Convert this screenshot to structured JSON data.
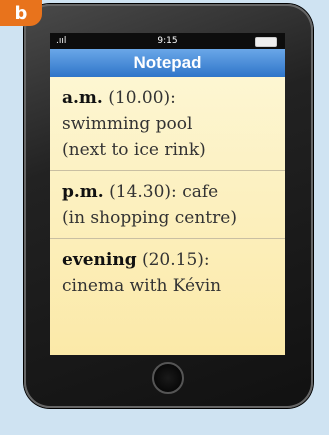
{
  "badge": "b",
  "statusbar": {
    "signal": ".ııl",
    "time": "9:15"
  },
  "app": {
    "title": "Notepad"
  },
  "notes": [
    {
      "label": "a.m.",
      "time": "(10.00):",
      "line1": "",
      "line2": "swimming pool",
      "line3": "(next to ice rink)"
    },
    {
      "label": "p.m.",
      "time": "(14.30):",
      "line1": "cafe",
      "line2": "(in shopping centre)",
      "line3": ""
    },
    {
      "label": "evening",
      "time": "(20.15):",
      "line1": "",
      "line2": "cinema with Kévin",
      "line3": ""
    }
  ]
}
